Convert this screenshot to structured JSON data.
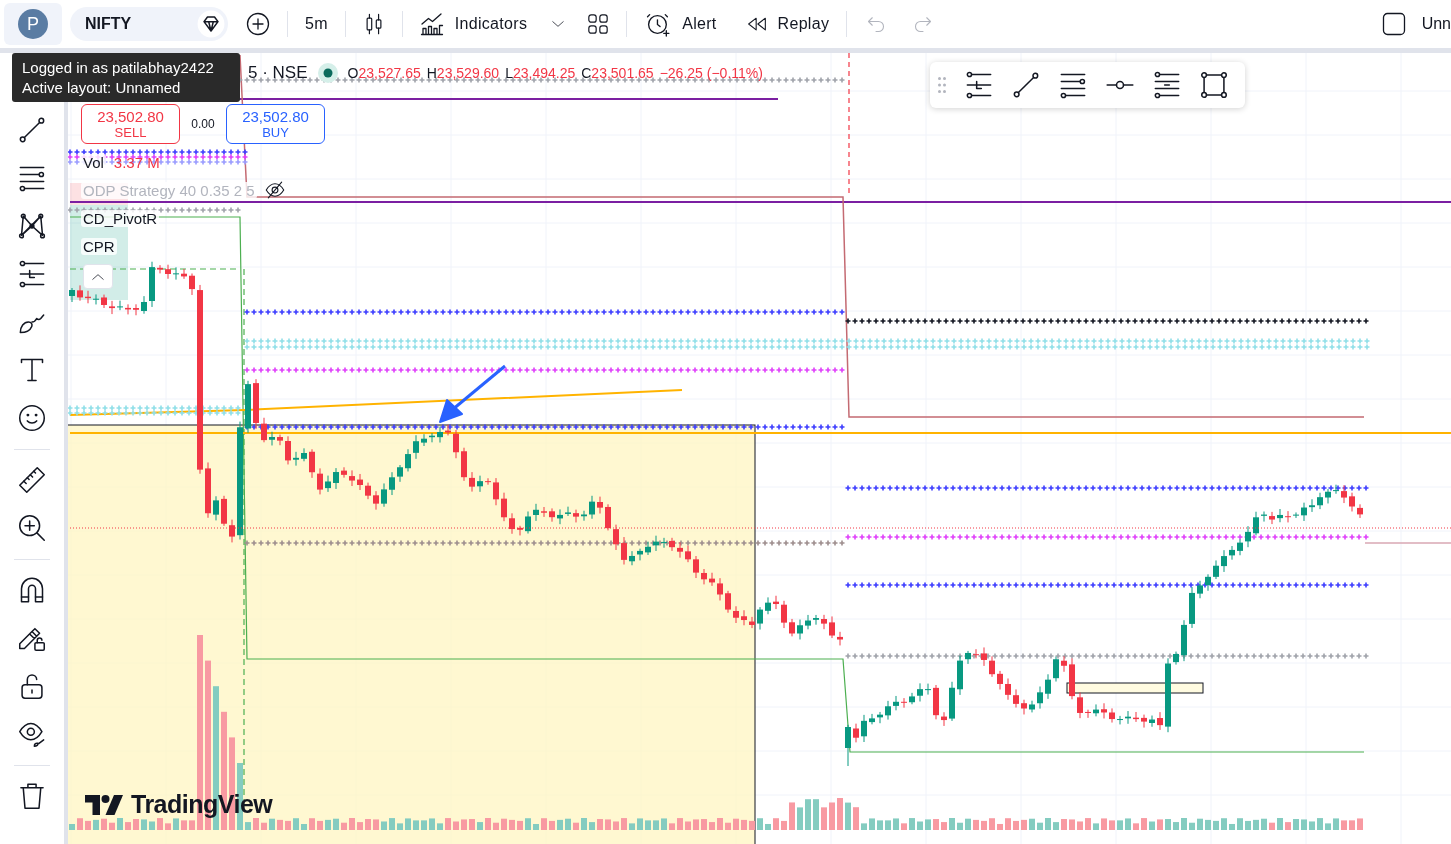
{
  "top_bar": {
    "avatar": "P",
    "symbol": "NIFTY",
    "interval": "5m",
    "buttons": [
      {
        "kind": "indicators",
        "label": "Indicators"
      },
      {
        "kind": "alert",
        "label": "Alert"
      },
      {
        "kind": "replay",
        "label": "Replay"
      }
    ],
    "history": [
      {
        "kind": "undo",
        "disabled": true
      },
      {
        "kind": "redo",
        "disabled": true
      }
    ],
    "layout": "Unn"
  },
  "tooltip": {
    "lines": [
      "Logged in as patilabhay2422",
      "Active layout: Unnamed"
    ]
  },
  "legend": {
    "symbol": "5 · NSE",
    "ohlc": [
      {
        "label": "O",
        "value": "23,527.65"
      },
      {
        "label": "H",
        "value": "23,529.60"
      },
      {
        "label": "L",
        "value": "23,494.25"
      },
      {
        "label": "C",
        "value": "23,501.65"
      }
    ],
    "change": "−26.25 (−0.11%)"
  },
  "order_panel": {
    "sell": {
      "price": "23,502.80",
      "label": "SELL"
    },
    "spread": "0.00",
    "buy": {
      "price": "23,502.80",
      "label": "BUY"
    }
  },
  "indicators": [
    {
      "name": "Vol",
      "value": "3.37 M",
      "hidden": false
    },
    {
      "name": "ODP Strategy 40 0.35 2 5",
      "hidden": true
    },
    {
      "name": "CD_PivotR",
      "hidden": false
    },
    {
      "name": "CPR",
      "hidden": false
    }
  ],
  "logo": "TradingView"
}
